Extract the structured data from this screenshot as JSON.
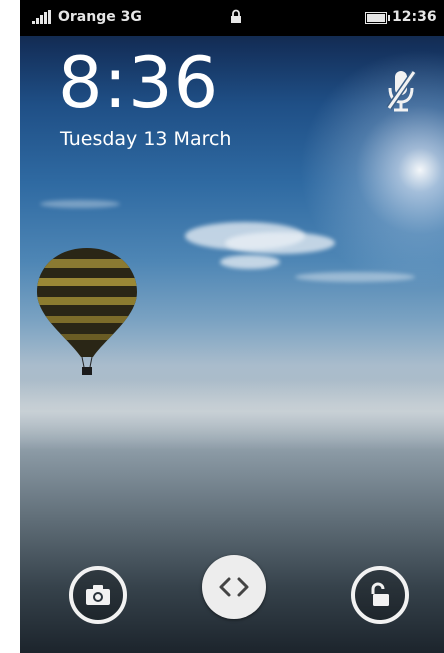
{
  "status_bar": {
    "carrier": "Orange 3G",
    "time": "12:36",
    "icons": [
      "signal-icon",
      "lock-icon",
      "battery-icon"
    ]
  },
  "lockscreen": {
    "time": "8:36",
    "date": "Tuesday 13 March",
    "mute_icon": "microphone-muted-icon",
    "actions": [
      {
        "name": "camera",
        "icon": "camera-icon"
      },
      {
        "name": "handle",
        "icon": "chevrons-icon"
      },
      {
        "name": "unlock",
        "icon": "padlock-open-icon"
      }
    ]
  },
  "colors": {
    "status_bar_bg": "#000000",
    "text": "#ffffff",
    "handle_bg": "#ededed"
  }
}
